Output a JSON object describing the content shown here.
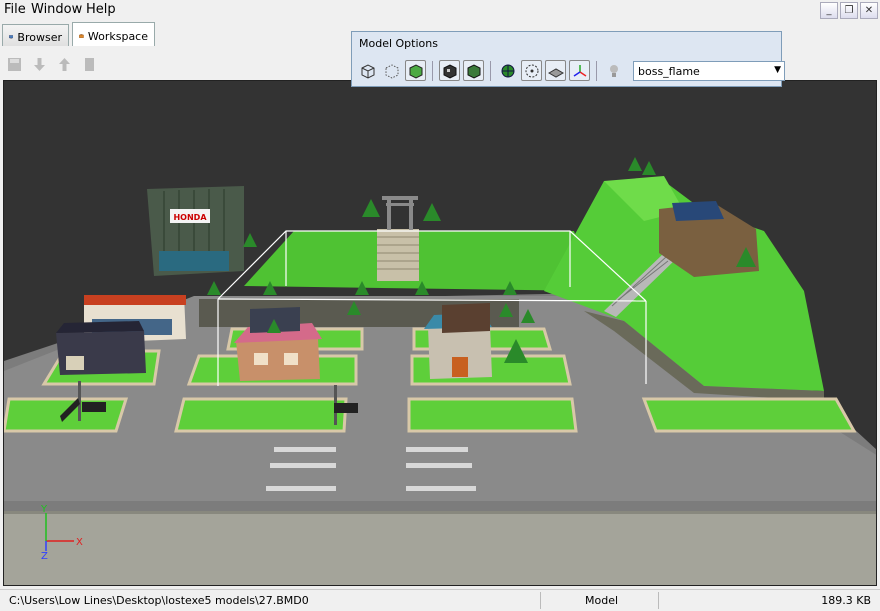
{
  "menu": {
    "file": "File",
    "window": "Window",
    "help": "Help"
  },
  "window_controls": {
    "minimize": "_",
    "restore": "❐",
    "close": "✕"
  },
  "tabs": [
    {
      "label": "Browser"
    },
    {
      "label": "Workspace"
    }
  ],
  "model_options": {
    "title": "Model Options",
    "selected_model": "boss_flame"
  },
  "viewport": {
    "scene_text": {
      "honda_sign": "HONDA"
    },
    "axis_labels": {
      "x": "X",
      "y": "Y",
      "z": "Z"
    }
  },
  "status": {
    "path": "C:\\Users\\Low Lines\\Desktop\\lostexe5 models\\27.BMD0",
    "mode": "Model",
    "size": "189.3 KB"
  },
  "colors": {
    "grass": "#5ecf3a",
    "road": "#8a8a8a",
    "viewport_bg": "#333333",
    "panel_bg": "#dde6f2"
  }
}
